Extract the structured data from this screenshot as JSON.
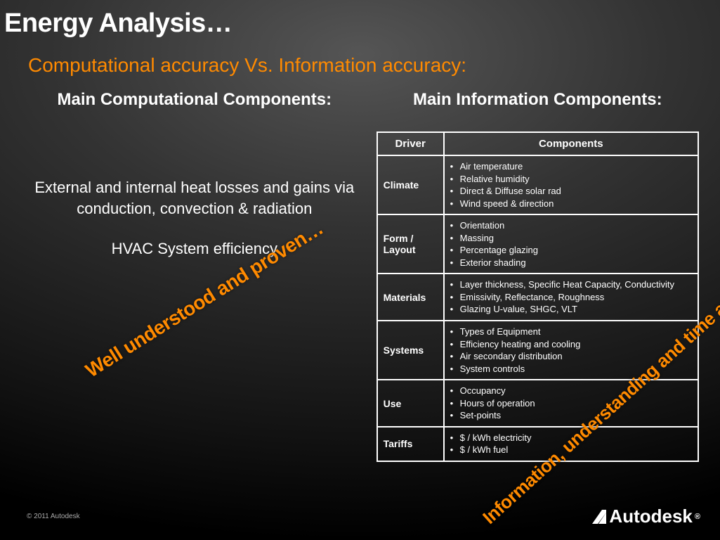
{
  "title": "Energy Analysis…",
  "subtitle": "Computational accuracy Vs. Information accuracy:",
  "left": {
    "heading": "Main Computational Components:",
    "para1": "External and internal heat losses and gains via conduction, convection & radiation",
    "para2": "HVAC System efficiency"
  },
  "right": {
    "heading": "Main Information Components:",
    "headers": {
      "driver": "Driver",
      "components": "Components"
    },
    "rows": [
      {
        "driver": "Climate",
        "items": [
          "Air temperature",
          "Relative humidity",
          "Direct & Diffuse solar rad",
          "Wind speed & direction"
        ]
      },
      {
        "driver": "Form / Layout",
        "items": [
          "Orientation",
          "Massing",
          "Percentage glazing",
          "Exterior shading"
        ]
      },
      {
        "driver": "Materials",
        "items": [
          "Layer thickness, Specific Heat Capacity, Conductivity",
          "Emissivity, Reflectance, Roughness",
          "Glazing U-value, SHGC, VLT"
        ]
      },
      {
        "driver": "Systems",
        "items": [
          "Types of Equipment",
          "Efficiency heating and cooling",
          "Air secondary distribution",
          "System controls"
        ]
      },
      {
        "driver": "Use",
        "items": [
          "Occupancy",
          "Hours of operation",
          "Set-points"
        ]
      },
      {
        "driver": "Tariffs",
        "items": [
          "$ / kWh electricity",
          "$ / kWh fuel"
        ]
      }
    ]
  },
  "overlays": {
    "left": "Well understood and proven…",
    "right": "Information, understanding and time are by far the weakest links…"
  },
  "footer": "© 2011 Autodesk",
  "logo": {
    "text": "Autodesk",
    "reg": "®"
  }
}
